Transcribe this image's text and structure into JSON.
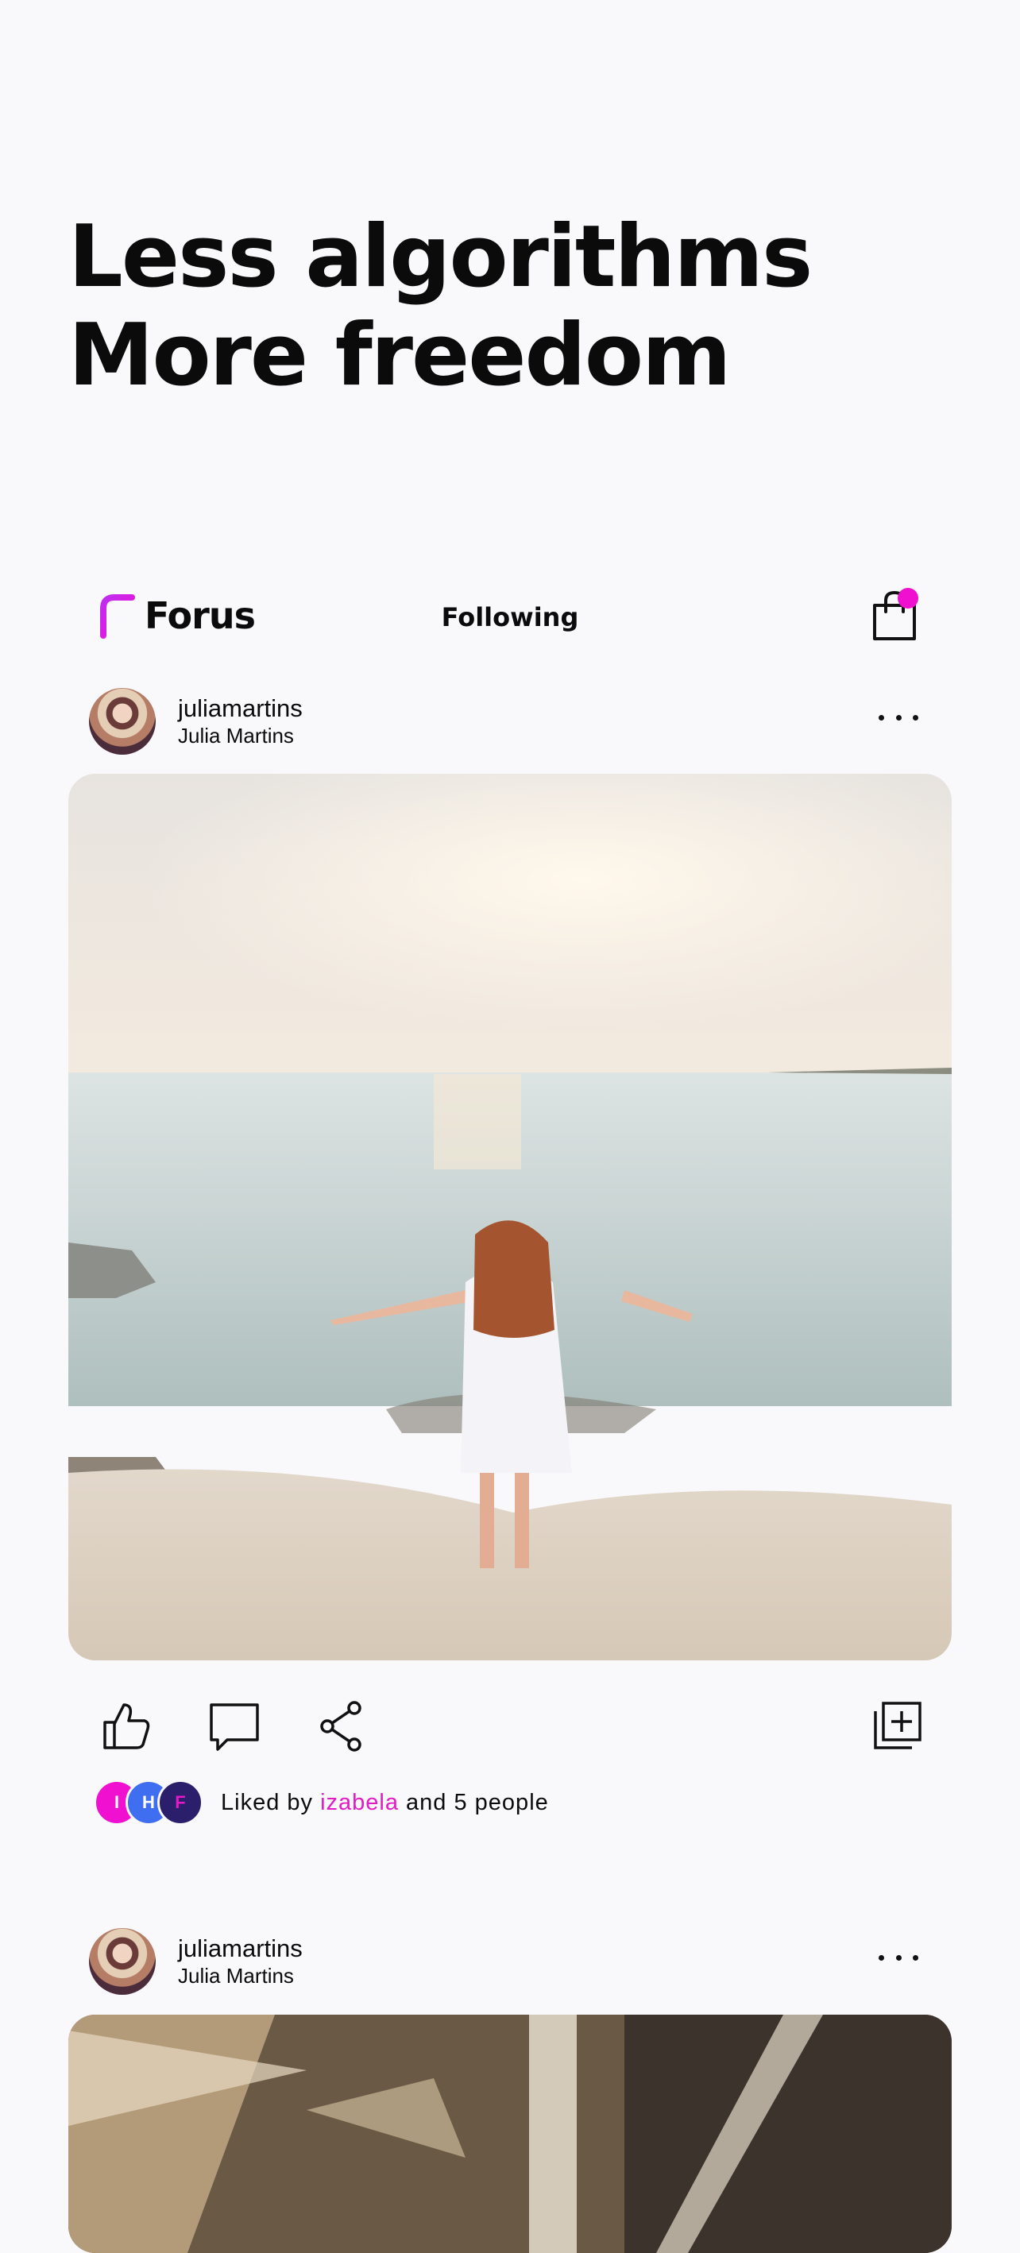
{
  "hero": {
    "line1": "Less algorithms",
    "line2": "More freedom"
  },
  "header": {
    "brand": "Forus",
    "feed_title": "Following",
    "logo_icon": "forus-logo-icon",
    "cart_icon": "shopping-bag-icon",
    "accent": "#f010d0"
  },
  "posts": [
    {
      "username": "juliamartins",
      "display_name": "Julia Martins"
    },
    {
      "username": "juliamartins",
      "display_name": "Julia Martins"
    }
  ],
  "actions": {
    "like_icon": "thumbs-up-icon",
    "comment_icon": "comment-icon",
    "share_icon": "share-icon",
    "save_icon": "add-to-collection-icon"
  },
  "likes": {
    "avatars": [
      {
        "initial": "I",
        "color": "#f010d0"
      },
      {
        "initial": "H",
        "color": "#3f6ff0"
      },
      {
        "initial": "F",
        "color": "#2b1e6a"
      }
    ],
    "prefix": "Liked by",
    "user": "izabela",
    "suffix": "and 5 people"
  }
}
